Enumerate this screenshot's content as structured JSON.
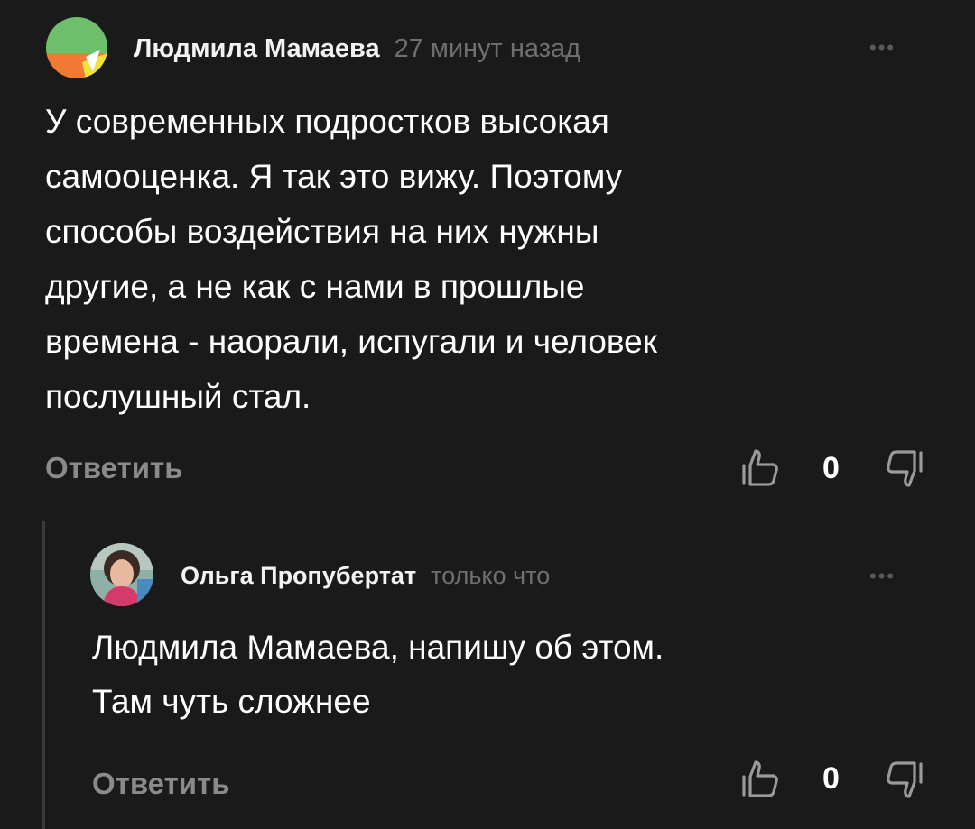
{
  "comments": [
    {
      "author": "Людмила Мамаева",
      "time": "27 минут назад",
      "more": "•••",
      "text_lines": [
        "У современных подростков высокая",
        "самооценка. Я так это вижу. Поэтому",
        "способы воздействия на них нужны",
        "другие, а не как с нами в прошлые",
        "времена - наорали, испугали и человек",
        "послушный стал."
      ],
      "reply_label": "Ответить",
      "likes": "0"
    },
    {
      "author": "Ольга Пропубертат",
      "time": "только что",
      "more": "•••",
      "text_lines": [
        "Людмила Мамаева, напишу об этом.",
        "Там чуть сложнее"
      ],
      "reply_label": "Ответить",
      "likes": "0"
    }
  ],
  "colors": {
    "background": "#1a1a1a",
    "muted_text": "#8a8a8a",
    "timestamp": "#6f6f6f",
    "thread_line": "#3a3a3a"
  },
  "icons": {
    "like": "thumbs-up-icon",
    "dislike": "thumbs-down-icon",
    "more": "more-dots-icon"
  }
}
